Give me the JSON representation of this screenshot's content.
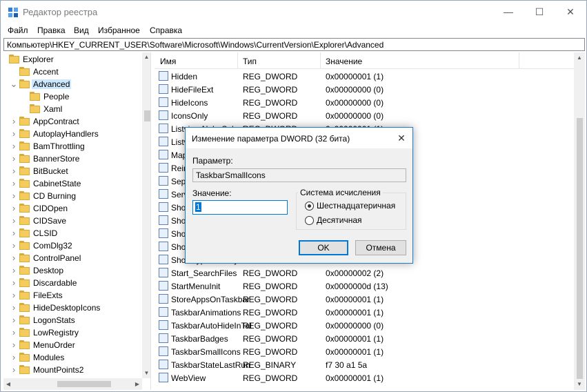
{
  "window": {
    "title": "Редактор реестра",
    "controls": {
      "minimize": "—",
      "maximize": "☐",
      "close": "✕"
    }
  },
  "menu": [
    "Файл",
    "Правка",
    "Вид",
    "Избранное",
    "Справка"
  ],
  "address": "Компьютер\\HKEY_CURRENT_USER\\Software\\Microsoft\\Windows\\CurrentVersion\\Explorer\\Advanced",
  "tree": {
    "items": [
      {
        "label": "Explorer",
        "level": 0,
        "expander": ""
      },
      {
        "label": "Accent",
        "level": 1,
        "expander": ""
      },
      {
        "label": "Advanced",
        "level": 1,
        "expander": "v",
        "selected": true
      },
      {
        "label": "People",
        "level": 2,
        "expander": ""
      },
      {
        "label": "Xaml",
        "level": 2,
        "expander": ""
      },
      {
        "label": "AppContract",
        "level": 1,
        "expander": ">"
      },
      {
        "label": "AutoplayHandlers",
        "level": 1,
        "expander": ">"
      },
      {
        "label": "BamThrottling",
        "level": 1,
        "expander": ">"
      },
      {
        "label": "BannerStore",
        "level": 1,
        "expander": ">"
      },
      {
        "label": "BitBucket",
        "level": 1,
        "expander": ">"
      },
      {
        "label": "CabinetState",
        "level": 1,
        "expander": ">"
      },
      {
        "label": "CD Burning",
        "level": 1,
        "expander": ">"
      },
      {
        "label": "CIDOpen",
        "level": 1,
        "expander": ">"
      },
      {
        "label": "CIDSave",
        "level": 1,
        "expander": ">"
      },
      {
        "label": "CLSID",
        "level": 1,
        "expander": ">"
      },
      {
        "label": "ComDlg32",
        "level": 1,
        "expander": ">"
      },
      {
        "label": "ControlPanel",
        "level": 1,
        "expander": ">"
      },
      {
        "label": "Desktop",
        "level": 1,
        "expander": ">"
      },
      {
        "label": "Discardable",
        "level": 1,
        "expander": ">"
      },
      {
        "label": "FileExts",
        "level": 1,
        "expander": ">"
      },
      {
        "label": "HideDesktopIcons",
        "level": 1,
        "expander": ">"
      },
      {
        "label": "LogonStats",
        "level": 1,
        "expander": ">"
      },
      {
        "label": "LowRegistry",
        "level": 1,
        "expander": ">"
      },
      {
        "label": "MenuOrder",
        "level": 1,
        "expander": ">"
      },
      {
        "label": "Modules",
        "level": 1,
        "expander": ">"
      },
      {
        "label": "MountPoints2",
        "level": 1,
        "expander": ">"
      }
    ]
  },
  "list": {
    "columns": [
      "Имя",
      "Тип",
      "Значение"
    ],
    "rows": [
      {
        "name": "Hidden",
        "type": "REG_DWORD",
        "value": "0x00000001 (1)"
      },
      {
        "name": "HideFileExt",
        "type": "REG_DWORD",
        "value": "0x00000000 (0)"
      },
      {
        "name": "HideIcons",
        "type": "REG_DWORD",
        "value": "0x00000000 (0)"
      },
      {
        "name": "IconsOnly",
        "type": "REG_DWORD",
        "value": "0x00000000 (0)"
      },
      {
        "name": "ListviewAlphaSelect",
        "type": "REG_DWORD",
        "value": "0x00000001 (1)"
      },
      {
        "name": "ListviewShadow",
        "type": "",
        "value": ""
      },
      {
        "name": "MapNetDrvBtn",
        "type": "",
        "value": ""
      },
      {
        "name": "ReindexedProfile",
        "type": "",
        "value": ""
      },
      {
        "name": "SeparateProcess",
        "type": "",
        "value": ""
      },
      {
        "name": "ServerAdminUI",
        "type": "",
        "value": ""
      },
      {
        "name": "ShowCompColor",
        "type": "",
        "value": ""
      },
      {
        "name": "ShowInfoTip",
        "type": "",
        "value": ""
      },
      {
        "name": "ShowStatusBar",
        "type": "",
        "value": ""
      },
      {
        "name": "ShowSuperHidden",
        "type": "",
        "value": ""
      },
      {
        "name": "ShowTypeOverlay",
        "type": "",
        "value": ""
      },
      {
        "name": "Start_SearchFiles",
        "type": "REG_DWORD",
        "value": "0x00000002 (2)"
      },
      {
        "name": "StartMenuInit",
        "type": "REG_DWORD",
        "value": "0x0000000d (13)"
      },
      {
        "name": "StoreAppsOnTaskbar",
        "type": "REG_DWORD",
        "value": "0x00000001 (1)"
      },
      {
        "name": "TaskbarAnimations",
        "type": "REG_DWORD",
        "value": "0x00000001 (1)"
      },
      {
        "name": "TaskbarAutoHideInTabletMode",
        "type": "REG_DWORD",
        "value": "0x00000000 (0)"
      },
      {
        "name": "TaskbarBadges",
        "type": "REG_DWORD",
        "value": "0x00000001 (1)"
      },
      {
        "name": "TaskbarSmallIcons",
        "type": "REG_DWORD",
        "value": "0x00000001 (1)"
      },
      {
        "name": "TaskbarStateLastRun",
        "type": "REG_BINARY",
        "value": "f7 30 a1 5a"
      },
      {
        "name": "WebView",
        "type": "REG_DWORD",
        "value": "0x00000001 (1)"
      }
    ]
  },
  "dialog": {
    "title": "Изменение параметра DWORD (32 бита)",
    "name_label": "Параметр:",
    "name_value": "TaskbarSmallIcons",
    "value_label": "Значение:",
    "value_value": "1",
    "base_label": "Система исчисления",
    "base_options": [
      "Шестнадцатеричная",
      "Десятичная"
    ],
    "base_selected": 0,
    "ok_label": "OK",
    "cancel_label": "Отмена",
    "close_glyph": "✕"
  },
  "colors": {
    "accent": "#0078d7",
    "selection": "#cce8ff",
    "folder": "#f3cc5c"
  }
}
